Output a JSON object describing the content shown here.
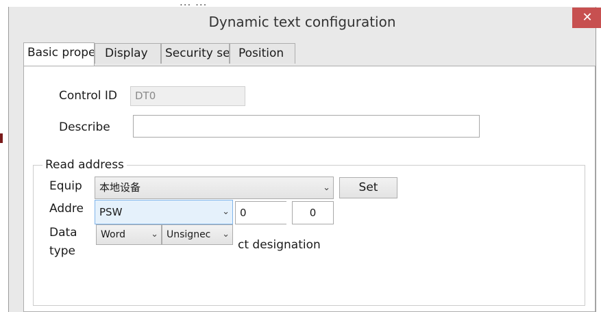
{
  "background_title": "... ...",
  "window": {
    "title": "Dynamic text configuration",
    "close_glyph": "✕"
  },
  "tabs": [
    {
      "label": "Basic prope",
      "active": true
    },
    {
      "label": "Display",
      "active": false
    },
    {
      "label": "Security se",
      "active": false
    },
    {
      "label": "Position",
      "active": false
    }
  ],
  "form": {
    "control_id_label": "Control ID",
    "control_id_value": "DT0",
    "describe_label": "Describe",
    "describe_value": ""
  },
  "read_address": {
    "group_label": "Read address",
    "equip_label": "Equip",
    "equip_value": "本地设备",
    "set_button": "Set",
    "addre_label": "Addre",
    "addre_value": "PSW",
    "addr_field_1": "0",
    "addr_field_2": "0",
    "data_type_label_line1": "Data",
    "data_type_label_line2": "type",
    "data_type_value": "Word",
    "sign_value": "Unsignec",
    "partial_text": "ct designation"
  },
  "icons": {
    "dropdown": "chevron-down-icon",
    "close": "close-icon"
  },
  "colors": {
    "close_button": "#c75050",
    "focus_select": "#e5f1fb",
    "titlebar": "#e9e9e9"
  }
}
